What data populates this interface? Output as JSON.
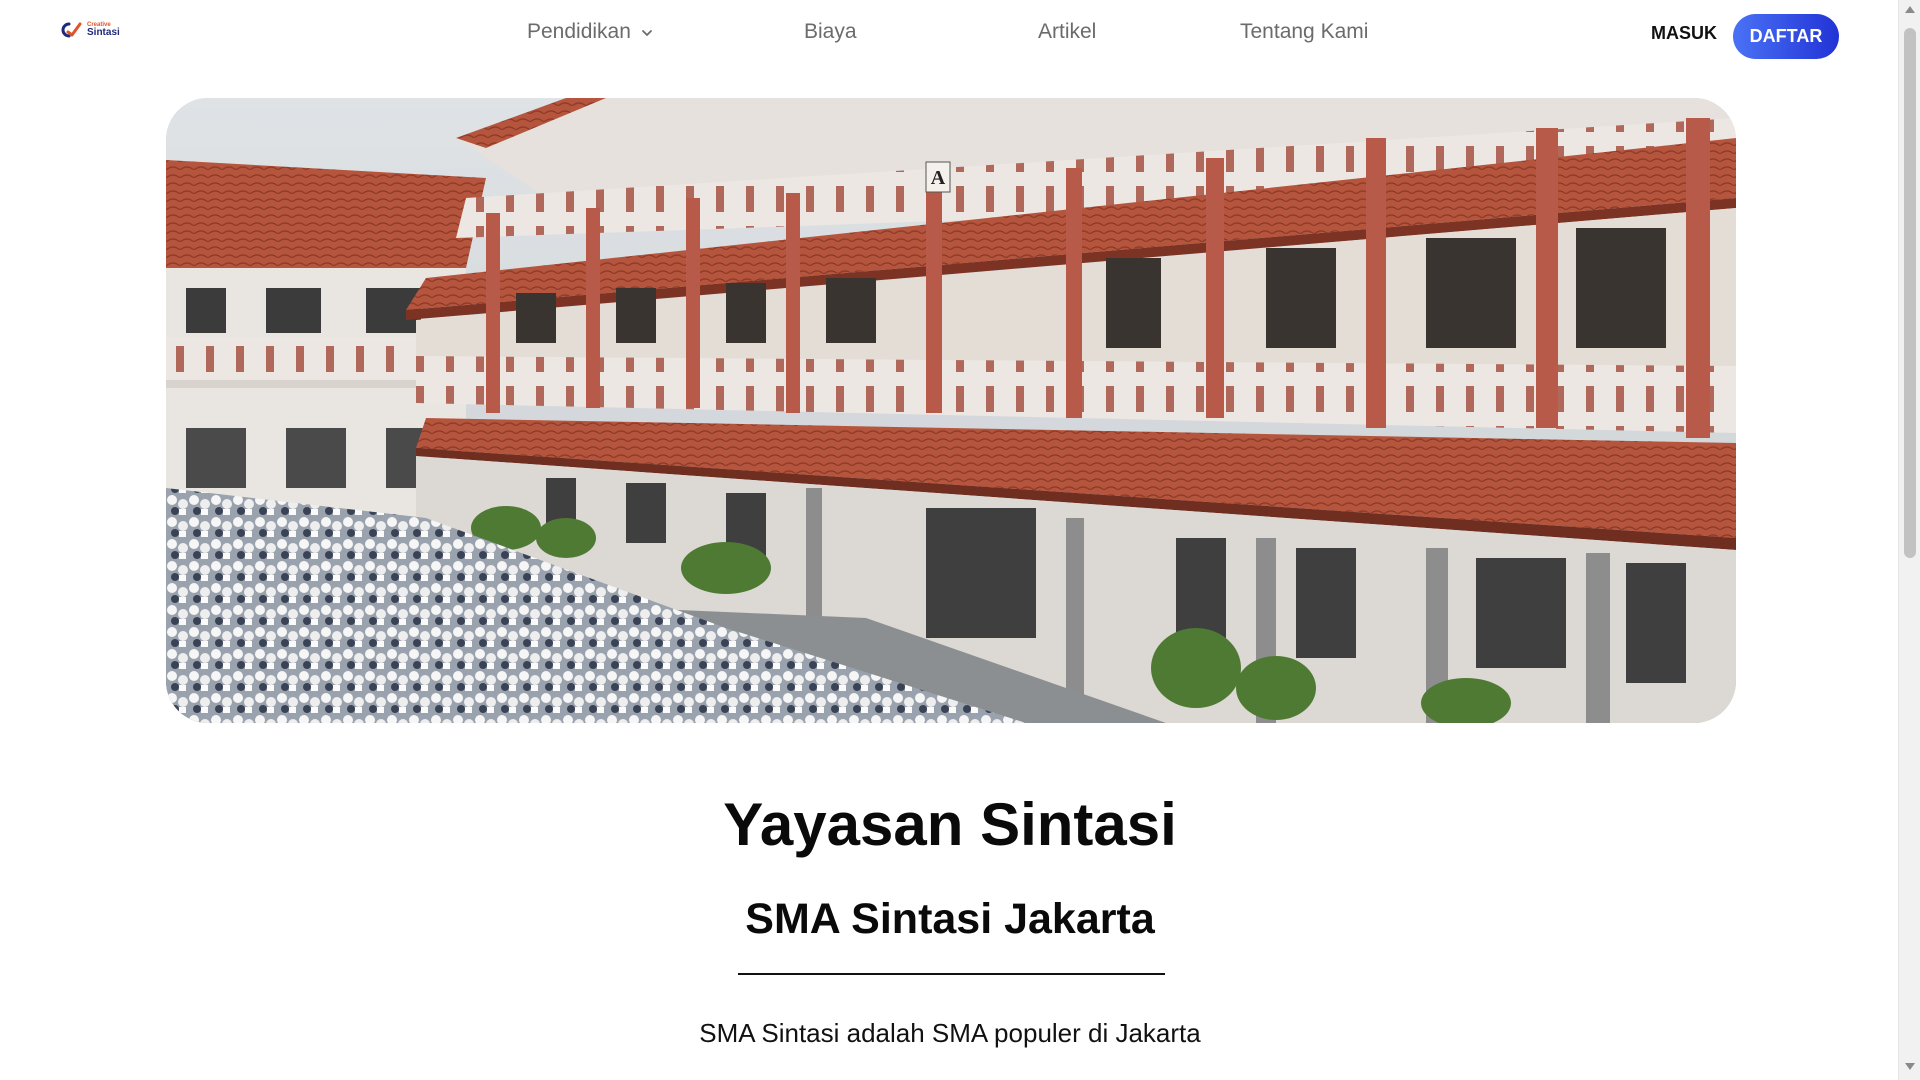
{
  "brand": {
    "name_small": "Creative",
    "name": "Sintasi",
    "colors": {
      "accent_orange": "#e0542a",
      "accent_blue": "#1f2a7a"
    }
  },
  "nav": {
    "items": [
      {
        "label": "Pendidikan",
        "has_dropdown": true
      },
      {
        "label": "Biaya"
      },
      {
        "label": "Artikel"
      },
      {
        "label": "Tentang Kami"
      }
    ],
    "login_label": "MASUK",
    "register_label": "DAFTAR"
  },
  "hero": {
    "image": "school-building-assembly-photo",
    "building_label": "A"
  },
  "content": {
    "title": "Yayasan Sintasi",
    "subtitle": "SMA Sintasi Jakarta",
    "description": "SMA Sintasi adalah SMA populer di Jakarta"
  },
  "theme": {
    "primary_gradient_start": "#4a72f5",
    "primary_gradient_end": "#2233d6"
  }
}
